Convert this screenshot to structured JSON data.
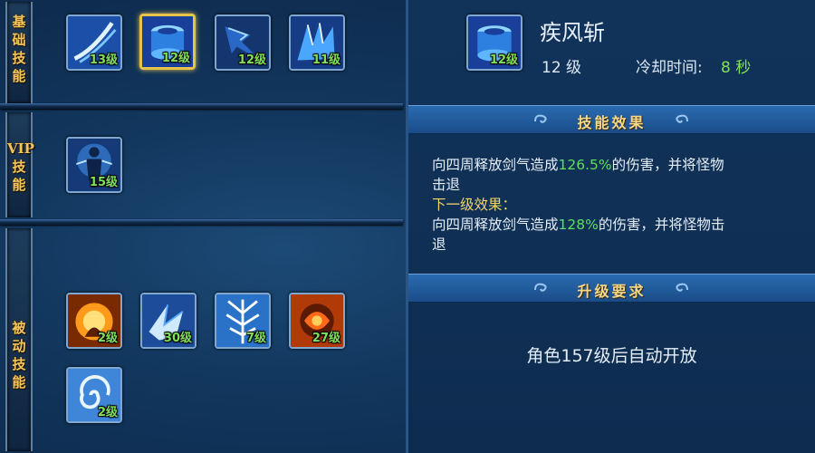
{
  "categories": [
    {
      "id": "basic",
      "label": "基础技能"
    },
    {
      "id": "vip",
      "label": "VIP技能"
    },
    {
      "id": "passive",
      "label": "被动技能"
    }
  ],
  "basic_skills": [
    {
      "level": "13级",
      "icon": "slash-skill-icon"
    },
    {
      "level": "12级",
      "icon": "whirlwind-skill-icon",
      "selected": true
    },
    {
      "level": "12级",
      "icon": "dash-strike-skill-icon"
    },
    {
      "level": "11级",
      "icon": "ice-wing-skill-icon"
    }
  ],
  "vip_skills": [
    {
      "level": "15级",
      "icon": "glowing-warrior-skill-icon"
    }
  ],
  "passive_skills": [
    {
      "level": "2级",
      "icon": "fire-burst-skill-icon"
    },
    {
      "level": "30级",
      "icon": "ice-shards-skill-icon"
    },
    {
      "level": "7级",
      "icon": "frost-tree-skill-icon"
    },
    {
      "level": "27级",
      "icon": "flame-orb-skill-icon"
    },
    {
      "level": "2级",
      "icon": "water-spiral-skill-icon"
    }
  ],
  "detail": {
    "icon_level": "12级",
    "name": "疾风斩",
    "level": "12 级",
    "cooldown_label": "冷却时间:",
    "cooldown_value": "8 秒",
    "effect_title": "技能效果",
    "effect_line1_a": "向四周释放剑气造成",
    "effect_line1_pct": "126.5%",
    "effect_line1_b": "的伤害，并将怪物",
    "effect_line2": "击退",
    "next_label": "下一级效果：",
    "next_line1_a": "向四周释放剑气造成",
    "next_line1_pct": "128%",
    "next_line1_b": "的伤害，并将怪物击",
    "next_line2": "退",
    "upgrade_title": "升级要求",
    "unlock_text": "角色157级后自动开放"
  },
  "colors": {
    "accent_gold": "#f3c55a",
    "level_green": "#7fe05a",
    "highlight_green": "#5ee05a"
  }
}
